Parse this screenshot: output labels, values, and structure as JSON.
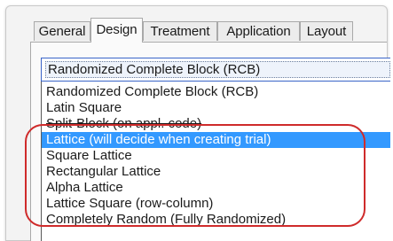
{
  "tabs": [
    {
      "label": "General",
      "active": false
    },
    {
      "label": "Design",
      "active": true
    },
    {
      "label": "Treatment",
      "active": false
    },
    {
      "label": "Application",
      "active": false
    },
    {
      "label": "Layout",
      "active": false
    }
  ],
  "design_combo": {
    "selected_value": "Randomized Complete Block (RCB)",
    "options": [
      {
        "label": "Randomized Complete Block (RCB)",
        "selected": false
      },
      {
        "label": "Latin Square",
        "selected": false
      },
      {
        "label": "Split-Block (on appl. code)",
        "selected": false
      },
      {
        "label": "Lattice (will decide when creating trial)",
        "selected": true
      },
      {
        "label": "Square Lattice",
        "selected": false
      },
      {
        "label": "Rectangular Lattice",
        "selected": false
      },
      {
        "label": "Alpha Lattice",
        "selected": false
      },
      {
        "label": "Lattice Square (row-column)",
        "selected": false
      },
      {
        "label": "Completely Random (Fully Randomized)",
        "selected": false
      }
    ]
  },
  "colors": {
    "selection": "#3399ff",
    "annotation_ring": "#cf2b2b",
    "combo_border": "#3a64c8"
  }
}
